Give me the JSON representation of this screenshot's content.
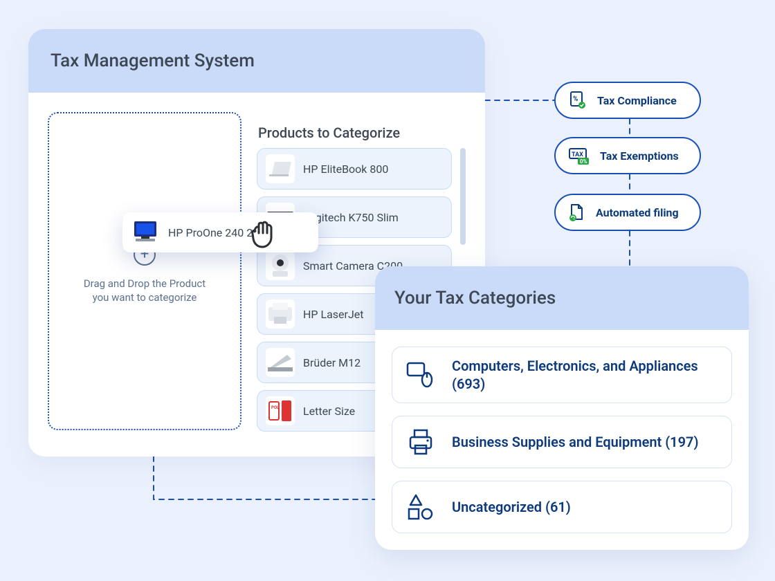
{
  "main": {
    "title": "Tax Management System",
    "dropzone_hint": "Drag and Drop the Product you want to categorize",
    "products_heading": "Products to Categorize",
    "products": [
      {
        "name": "HP EliteBook 800"
      },
      {
        "name": "Logitech K750 Slim"
      },
      {
        "name": "Smart Camera C200"
      },
      {
        "name": "HP LaserJet"
      },
      {
        "name": "Brüder M12"
      },
      {
        "name": "Letter Size"
      }
    ],
    "dragging": {
      "name": "HP ProOne 240 23.8\""
    }
  },
  "pills": {
    "compliance": "Tax Compliance",
    "exemptions": "Tax Exemptions",
    "filing": "Automated filing"
  },
  "categories": {
    "title": "Your Tax Categories",
    "items": [
      {
        "label": "Computers, Electronics, and Appliances (693)"
      },
      {
        "label": "Business Supplies and Equipment (197)"
      },
      {
        "label": "Uncategorized (61)"
      }
    ]
  }
}
